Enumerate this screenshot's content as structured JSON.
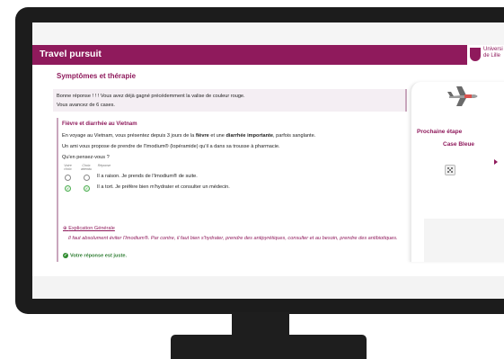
{
  "app": {
    "title": "Travel pursuit",
    "logo_text": "Universi\nde Lille"
  },
  "colors": {
    "brand": "#8f1a5c",
    "success": "#2e8b2e"
  },
  "section": {
    "title": "Symptômes et thérapie"
  },
  "feedback": {
    "line1": "Bonne réponse ! ! ! Vous avez déjà gagné précédemment la valise de couleur rouge.",
    "line2": "Vous avancez de 6 cases."
  },
  "question": {
    "title": "Fièvre et diarrhée au Vietnam",
    "text1_a": "En voyage au Vietnam, vous présentez depuis 3 jours de la ",
    "text1_b": "fièvre",
    "text1_c": " et une ",
    "text1_d": "diarrhée importante",
    "text1_e": ", parfois sanglante.",
    "text2": "Un ami vous propose de prendre de l'Imodium® (lopéramide) qu'il a dans sa trousse à pharmacie.",
    "prompt": "Qu'en pensez-vous ?",
    "columns": [
      "Votre choix",
      "Choix attendu",
      "Réponse"
    ],
    "answers": [
      {
        "text": "Il a raison. Je prends de l'Imodium® de suite.",
        "your_choice": false,
        "expected": false
      },
      {
        "text": "Il a tort. Je préfère bien m'hydrater et consulter un médecin.",
        "your_choice": true,
        "expected": true
      }
    ],
    "explanation_link": "Explication Générale",
    "explanation": "Il faut absolument éviter l'Imodium®. Par contre, il faut bien s'hydrater, prendre des antipyrétiques, consulter et au besoin, prendre des antibiotiques.",
    "result": "Votre réponse est juste."
  },
  "panel": {
    "plane_icon": "airplane-icon",
    "next_label": "Prochaine étape",
    "next_value": "Case Bleue",
    "dice_icon": "dice-icon"
  }
}
